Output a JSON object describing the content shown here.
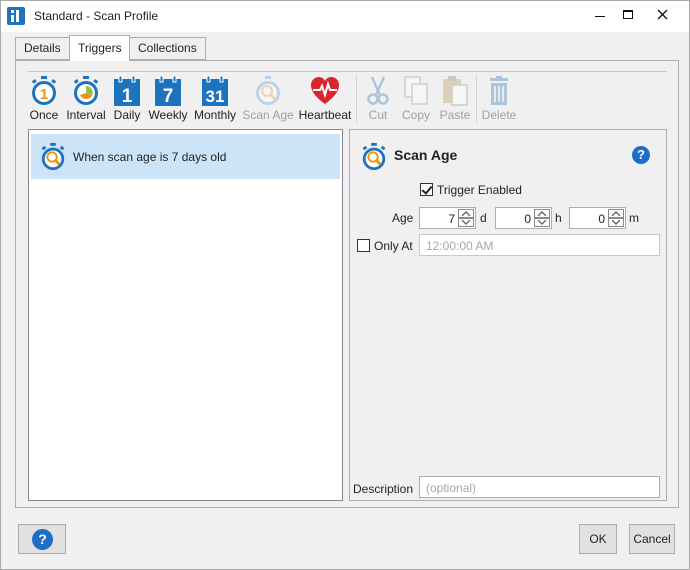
{
  "window": {
    "title": "Standard - Scan Profile"
  },
  "tabs": [
    {
      "label": "Details"
    },
    {
      "label": "Triggers"
    },
    {
      "label": "Collections"
    }
  ],
  "toolbar": {
    "once": "Once",
    "interval": "Interval",
    "daily": "Daily",
    "weekly": "Weekly",
    "monthly": "Monthly",
    "scan_age": "Scan Age",
    "heartbeat": "Heartbeat",
    "cut": "Cut",
    "copy": "Copy",
    "paste": "Paste",
    "delete": "Delete",
    "daily_num": "1",
    "weekly_num": "7",
    "monthly_num": "31"
  },
  "list": {
    "items": [
      {
        "label": "When scan age is 7 days old",
        "icon": "stopwatch-magnifier-icon"
      }
    ]
  },
  "detail": {
    "title": "Scan Age",
    "trigger_enabled_label": "Trigger Enabled",
    "trigger_enabled": true,
    "age_label": "Age",
    "age_days": "7",
    "age_days_unit": "d",
    "age_hours": "0",
    "age_hours_unit": "h",
    "age_minutes": "0",
    "age_minutes_unit": "m",
    "only_at_label": "Only At",
    "only_at_checked": false,
    "only_at_time": "12:00:00 AM",
    "description_label": "Description",
    "description_placeholder": "(optional)"
  },
  "footer": {
    "help": "?",
    "ok": "OK",
    "cancel": "Cancel"
  },
  "colors": {
    "accent_blue": "#1e73be",
    "selection": "#cce4f7",
    "stopwatch_orange": "#f0920f",
    "heartbeat_red": "#d9262c",
    "disabled": "#a0a0a0"
  }
}
